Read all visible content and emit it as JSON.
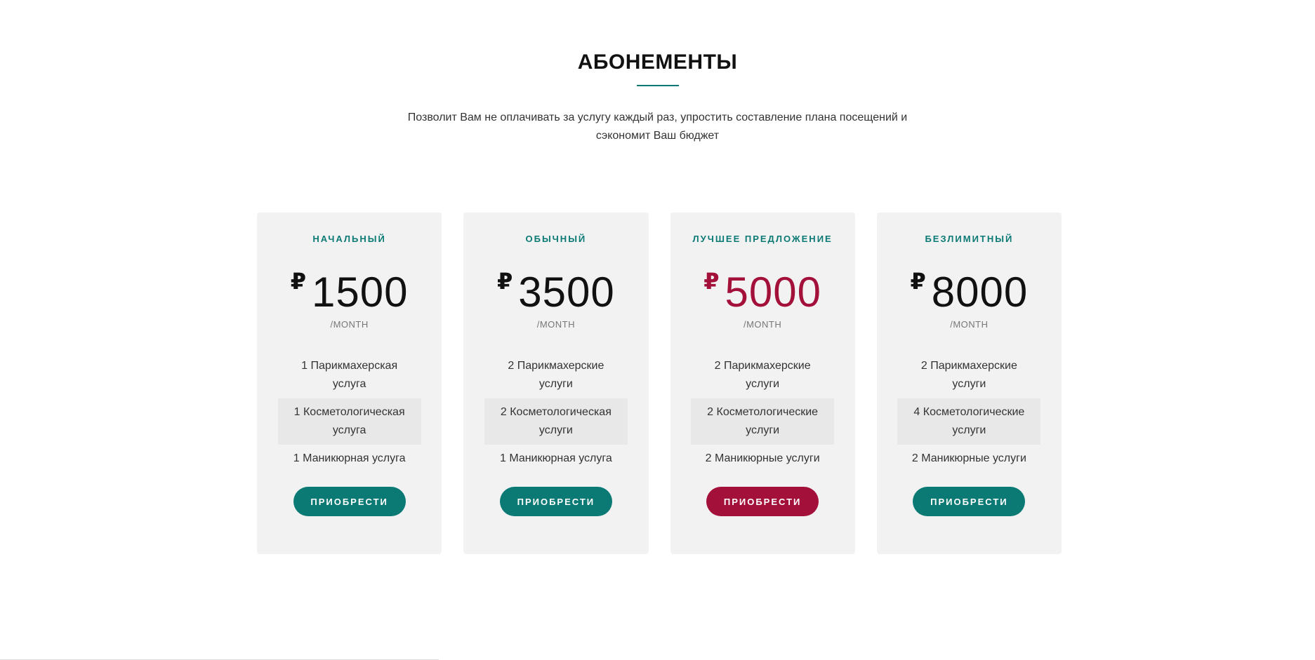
{
  "section": {
    "title": "АБОНЕМЕНТЫ",
    "subtitle": "Позволит Вам не оплачивать за услугу каждый раз, упростить составление плана посещений и сэкономит Ваш бюджет"
  },
  "colors": {
    "accent": "#0b7a75",
    "featured": "#a3103a",
    "card_bg": "#f2f2f2"
  },
  "plans": [
    {
      "name": "НАЧАЛЬНЫЙ",
      "currency": "₽",
      "price": "1500",
      "period": "/MONTH",
      "features": [
        "1 Парикмахерская услуга",
        "1 Косметологическая услуга",
        "1 Маникюрная услуга"
      ],
      "button": "ПРИОБРЕСТИ"
    },
    {
      "name": "ОБЫЧНЫЙ",
      "currency": "₽",
      "price": "3500",
      "period": "/MONTH",
      "features": [
        "2 Парикмахерские услуги",
        "2 Косметологическая услуги",
        "1 Маникюрная услуга"
      ],
      "button": "ПРИОБРЕСТИ"
    },
    {
      "name": "ЛУЧШЕЕ ПРЕДЛОЖЕНИЕ",
      "currency": "₽",
      "price": "5000",
      "period": "/MONTH",
      "features": [
        "2 Парикмахерские услуги",
        "2 Косметологические услуги",
        "2 Маникюрные услуги"
      ],
      "button": "ПРИОБРЕСТИ",
      "featured": true
    },
    {
      "name": "БЕЗЛИМИТНЫЙ",
      "currency": "₽",
      "price": "8000",
      "period": "/MONTH",
      "features": [
        "2 Парикмахерские услуги",
        "4 Косметологические услуги",
        "2 Маникюрные услуги"
      ],
      "button": "ПРИОБРЕСТИ"
    }
  ]
}
